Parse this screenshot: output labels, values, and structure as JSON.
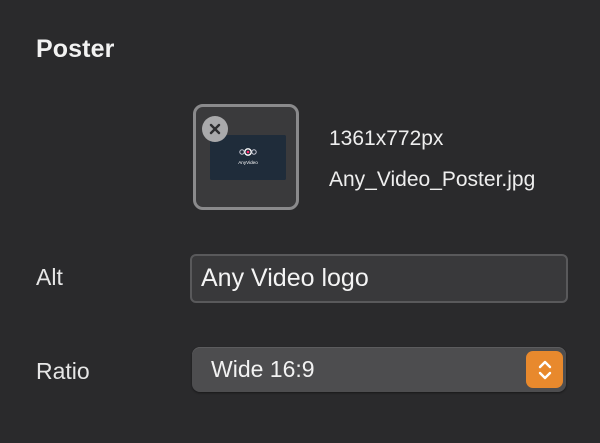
{
  "section": {
    "title": "Poster"
  },
  "poster": {
    "dimensions": "1361x772px",
    "filename": "Any_Video_Poster.jpg",
    "thumbnail_caption": "AnyVideo",
    "remove_icon": "close-icon",
    "thumb_bg_color": "#1f2c3a"
  },
  "fields": {
    "alt": {
      "label": "Alt",
      "value": "Any Video logo"
    },
    "ratio": {
      "label": "Ratio",
      "selected": "Wide 16:9",
      "stepper_icon": "chevron-up-down-icon",
      "accent_color": "#e8892d"
    }
  }
}
